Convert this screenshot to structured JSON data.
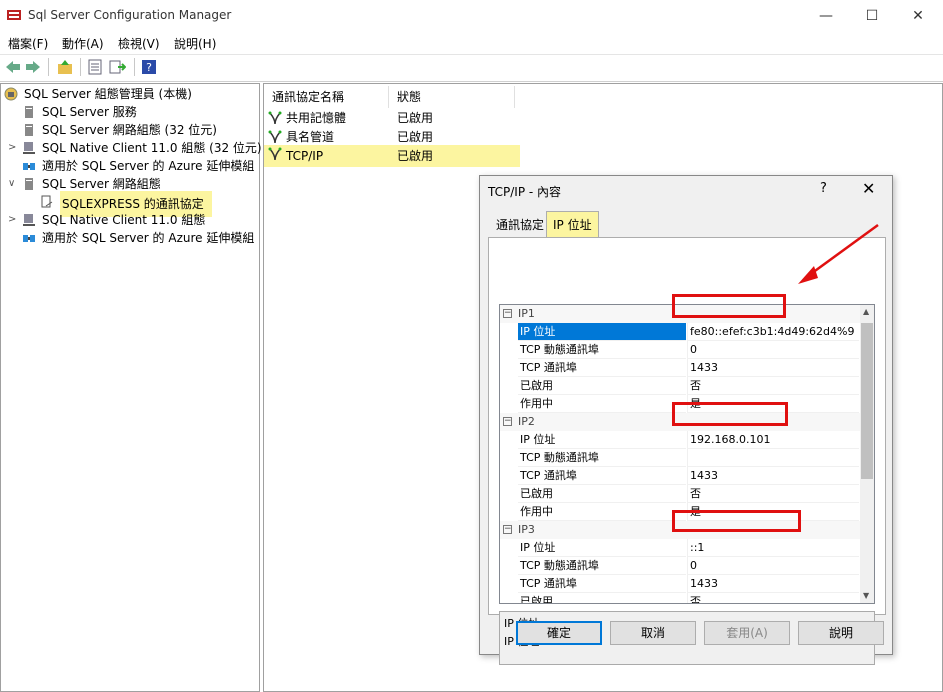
{
  "window": {
    "title": "Sql Server Configuration Manager",
    "min": "—",
    "max": "☐",
    "close": "✕"
  },
  "menu": [
    "檔案(F)",
    "動作(A)",
    "檢視(V)",
    "說明(H)"
  ],
  "tree": [
    {
      "label": "SQL Server 組態管理員 (本機)",
      "level": 0,
      "exp": ""
    },
    {
      "label": "SQL Server 服務",
      "level": 1,
      "exp": ""
    },
    {
      "label": "SQL Server 網路組態 (32 位元)",
      "level": 1,
      "exp": ""
    },
    {
      "label": "SQL Native Client 11.0 組態 (32 位元)",
      "level": 1,
      "exp": ">"
    },
    {
      "label": "適用於 SQL Server 的 Azure 延伸模組",
      "level": 1,
      "exp": ""
    },
    {
      "label": "SQL Server 網路組態",
      "level": 1,
      "exp": "∨"
    },
    {
      "label": "SQLEXPRESS 的通訊協定",
      "level": 2,
      "exp": ""
    },
    {
      "label": "SQL Native Client 11.0 組態",
      "level": 1,
      "exp": ">"
    },
    {
      "label": "適用於 SQL Server 的 Azure 延伸模組",
      "level": 1,
      "exp": ""
    }
  ],
  "list": {
    "headers": [
      "通訊協定名稱",
      "狀態"
    ],
    "rows": [
      [
        "共用記憶體",
        "已啟用"
      ],
      [
        "具名管道",
        "已啟用"
      ],
      [
        "TCP/IP",
        "已啟用"
      ]
    ]
  },
  "dialog": {
    "title": "TCP/IP - 內容",
    "help": "?",
    "close": "✕",
    "tabs": [
      "通訊協定",
      "IP 位址"
    ],
    "grid": [
      {
        "type": "section",
        "label": "IP1"
      },
      {
        "name": "IP 位址",
        "value": "fe80::efef:c3b1:4d49:62d4%9",
        "sel": true
      },
      {
        "name": "TCP 動態通訊埠",
        "value": "0"
      },
      {
        "name": "TCP 通訊埠",
        "value": "1433"
      },
      {
        "name": "已啟用",
        "value": "否"
      },
      {
        "name": "作用中",
        "value": "是"
      },
      {
        "type": "section",
        "label": "IP2"
      },
      {
        "name": "IP 位址",
        "value": "192.168.0.101"
      },
      {
        "name": "TCP 動態通訊埠",
        "value": ""
      },
      {
        "name": "TCP 通訊埠",
        "value": "1433"
      },
      {
        "name": "已啟用",
        "value": "否"
      },
      {
        "name": "作用中",
        "value": "是"
      },
      {
        "type": "section",
        "label": "IP3"
      },
      {
        "name": "IP 位址",
        "value": "::1"
      },
      {
        "name": "TCP 動態通訊埠",
        "value": "0"
      },
      {
        "name": "TCP 通訊埠",
        "value": "1433"
      },
      {
        "name": "已啟用",
        "value": "否"
      }
    ],
    "desc_title": "IP 位址",
    "desc_text": "IP 位址",
    "buttons": [
      "確定",
      "取消",
      "套用(A)",
      "說明"
    ]
  },
  "colors": {
    "highlight": "#fcf5a0",
    "annotation": "#e01010",
    "selection": "#0078d7"
  }
}
